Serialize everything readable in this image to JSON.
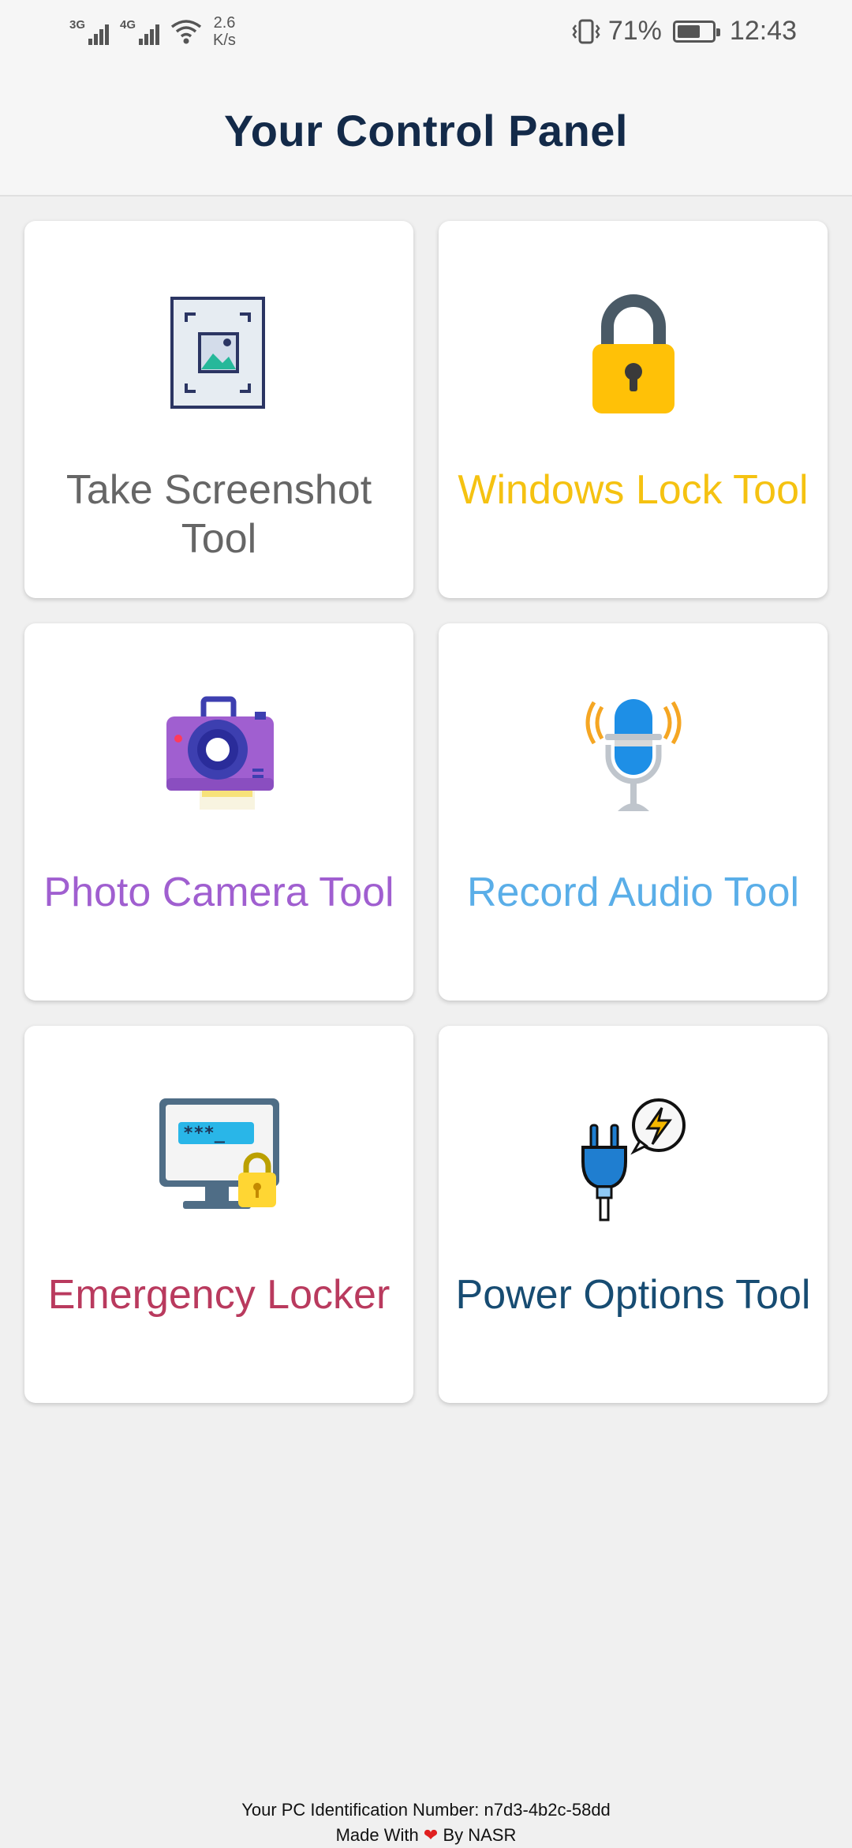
{
  "status_bar": {
    "network_1": "3G",
    "network_2": "4G",
    "speed_value": "2.6",
    "speed_unit": "K/s",
    "battery": "71%",
    "battery_level": 0.71,
    "time": "12:43"
  },
  "header": {
    "title": "Your Control Panel"
  },
  "tools": [
    {
      "label": "Take Screenshot Tool",
      "color": "#666666",
      "icon": "screenshot-icon"
    },
    {
      "label": "Windows Lock Tool",
      "color": "#f5c211",
      "icon": "padlock-icon"
    },
    {
      "label": "Photo Camera Tool",
      "color": "#a05fd0",
      "icon": "camera-icon"
    },
    {
      "label": "Record Audio Tool",
      "color": "#5aaee8",
      "icon": "microphone-icon"
    },
    {
      "label": "Emergency Locker",
      "color": "#b93a5e",
      "icon": "monitor-lock-icon"
    },
    {
      "label": "Power Options Tool",
      "color": "#174c72",
      "icon": "power-plug-icon"
    }
  ],
  "footer": {
    "id_label": "Your PC Identification Number:",
    "id_value": "n7d3-4b2c-58dd",
    "made_with": "Made With",
    "by": "By NASR"
  }
}
